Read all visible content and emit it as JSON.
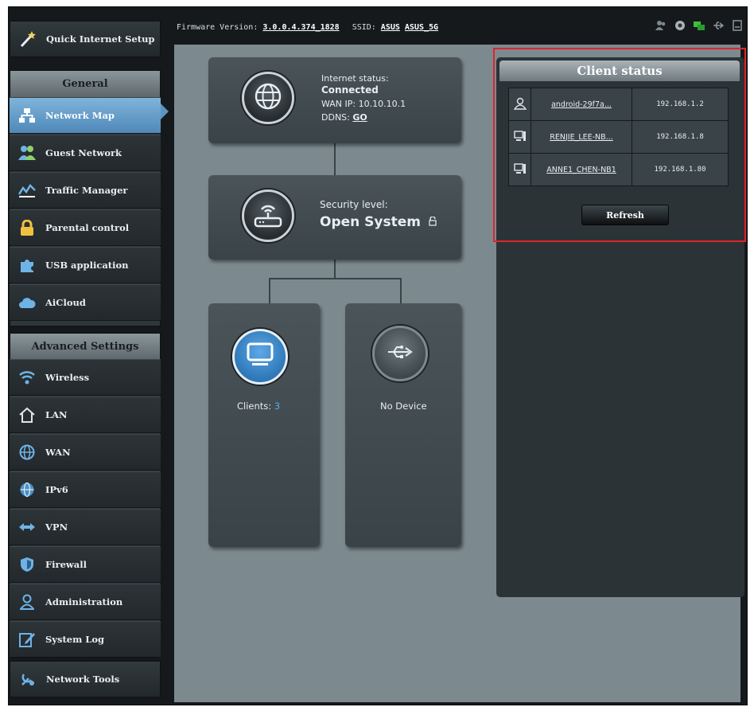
{
  "topbar": {
    "firmware_label": "Firmware Version:",
    "firmware_value": "3.0.0.4.374_1828",
    "ssid_label": "SSID:",
    "ssid_1": "ASUS",
    "ssid_2": "ASUS_5G"
  },
  "sidebar": {
    "quick_setup": "Quick Internet Setup",
    "general_header": "General",
    "general_items": [
      {
        "label": "Network Map",
        "icon": "network-map-icon"
      },
      {
        "label": "Guest Network",
        "icon": "guest-network-icon"
      },
      {
        "label": "Traffic Manager",
        "icon": "traffic-manager-icon"
      },
      {
        "label": "Parental control",
        "icon": "lock-icon"
      },
      {
        "label": "USB application",
        "icon": "puzzle-icon"
      },
      {
        "label": "AiCloud",
        "icon": "cloud-icon"
      }
    ],
    "advanced_header": "Advanced Settings",
    "advanced_items": [
      {
        "label": "Wireless",
        "icon": "wifi-icon"
      },
      {
        "label": "LAN",
        "icon": "home-icon"
      },
      {
        "label": "WAN",
        "icon": "globe-icon"
      },
      {
        "label": "IPv6",
        "icon": "ipv6-globe-icon"
      },
      {
        "label": "VPN",
        "icon": "vpn-icon"
      },
      {
        "label": "Firewall",
        "icon": "shield-icon"
      },
      {
        "label": "Administration",
        "icon": "admin-icon"
      },
      {
        "label": "System Log",
        "icon": "system-log-icon"
      }
    ],
    "network_tools": "Network Tools"
  },
  "map": {
    "internet": {
      "status_label": "Internet status:",
      "status_value": "Connected",
      "wan_ip_label": "WAN IP:",
      "wan_ip_value": "10.10.10.1",
      "ddns_label": "DDNS:",
      "ddns_value": "GO"
    },
    "security": {
      "label": "Security level:",
      "value": "Open System"
    },
    "clients": {
      "label": "Clients:",
      "count": "3"
    },
    "usb": {
      "label": "No Device"
    }
  },
  "client_status": {
    "title": "Client status",
    "rows": [
      {
        "name": "android-29f7a...",
        "ip": "192.168.1.2",
        "icon": "person-icon"
      },
      {
        "name": "RENJIE_LEE-NB...",
        "ip": "192.168.1.8",
        "icon": "computer-icon"
      },
      {
        "name": "ANNE1_CHEN-NB1",
        "ip": "192.168.1.80",
        "icon": "computer-icon"
      }
    ],
    "refresh_label": "Refresh"
  },
  "colors": {
    "active_nav": "#5b93c1",
    "highlight_border": "#e0242b",
    "main_bg": "#7c8a90",
    "clients_circle": "#3d86c6",
    "client_count": "#5aa9e8"
  }
}
